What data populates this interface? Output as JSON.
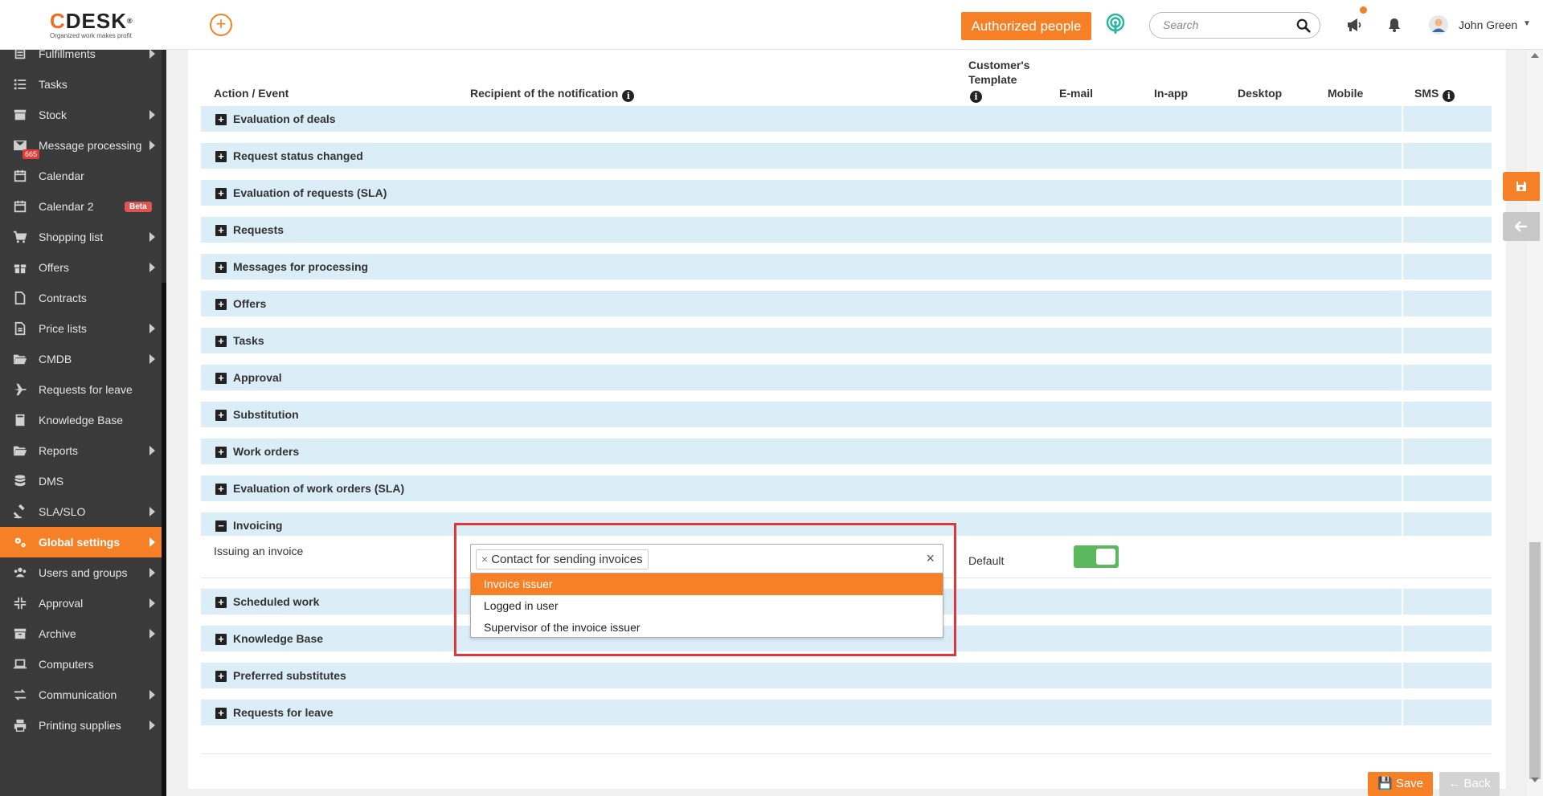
{
  "header": {
    "logo_text": "DESK",
    "logo_c": "C",
    "logo_reg": "®",
    "logo_tagline": "Organized work makes profit",
    "add_symbol": "+",
    "authorized_people_label": "Authorized people",
    "search_placeholder": "Search",
    "user_name": "John Green",
    "user_caret": "▼"
  },
  "sidebar": {
    "items": [
      {
        "label": "Fulfillments",
        "icon": "fulfillment-icon",
        "arrow": true
      },
      {
        "label": "Tasks",
        "icon": "tasks-icon",
        "arrow": false
      },
      {
        "label": "Stock",
        "icon": "stock-icon",
        "arrow": true
      },
      {
        "label": "Message processing",
        "icon": "envelope-icon",
        "arrow": true,
        "badge": "665"
      },
      {
        "label": "Calendar",
        "icon": "calendar-icon",
        "arrow": false
      },
      {
        "label": "Calendar 2",
        "icon": "calendar-icon",
        "arrow": false,
        "beta": "Beta"
      },
      {
        "label": "Shopping list",
        "icon": "cart-icon",
        "arrow": true
      },
      {
        "label": "Offers",
        "icon": "gift-icon",
        "arrow": true
      },
      {
        "label": "Contracts",
        "icon": "contract-icon",
        "arrow": false
      },
      {
        "label": "Price lists",
        "icon": "document-icon",
        "arrow": true
      },
      {
        "label": "CMDB",
        "icon": "folder-open-icon",
        "arrow": true
      },
      {
        "label": "Requests for leave",
        "icon": "plane-icon",
        "arrow": false
      },
      {
        "label": "Knowledge Base",
        "icon": "book-icon",
        "arrow": false
      },
      {
        "label": "Reports",
        "icon": "folder-open-icon",
        "arrow": true
      },
      {
        "label": "DMS",
        "icon": "database-icon",
        "arrow": false
      },
      {
        "label": "SLA/SLO",
        "icon": "gavel-icon",
        "arrow": true
      },
      {
        "label": "Global settings",
        "icon": "gears-icon",
        "arrow": true,
        "active": true
      },
      {
        "label": "Users and groups",
        "icon": "users-icon",
        "arrow": true
      },
      {
        "label": "Approval",
        "icon": "compress-icon",
        "arrow": true
      },
      {
        "label": "Archive",
        "icon": "archive-icon",
        "arrow": true
      },
      {
        "label": "Computers",
        "icon": "laptop-icon",
        "arrow": false
      },
      {
        "label": "Communication",
        "icon": "exchange-icon",
        "arrow": true
      },
      {
        "label": "Printing supplies",
        "icon": "printer-icon",
        "arrow": true
      }
    ]
  },
  "table": {
    "columns": {
      "action_event": "Action / Event",
      "recipient": "Recipient of the notification",
      "customers_template_line1": "Customer's",
      "customers_template_line2": "Template",
      "email": "E-mail",
      "in_app": "In-app",
      "desktop": "Desktop",
      "mobile": "Mobile",
      "sms": "SMS"
    },
    "info_glyph": "i",
    "sections_top": [
      {
        "label": "Evaluation of deals",
        "expanded": false
      },
      {
        "label": "Request status changed",
        "expanded": false
      },
      {
        "label": "Evaluation of requests (SLA)",
        "expanded": false
      },
      {
        "label": "Requests",
        "expanded": false
      },
      {
        "label": "Messages for processing",
        "expanded": false
      },
      {
        "label": "Offers",
        "expanded": false
      },
      {
        "label": "Tasks",
        "expanded": false
      },
      {
        "label": "Approval",
        "expanded": false
      },
      {
        "label": "Substitution",
        "expanded": false
      },
      {
        "label": "Work orders",
        "expanded": false
      },
      {
        "label": "Evaluation of work orders (SLA)",
        "expanded": false
      },
      {
        "label": "Invoicing",
        "expanded": true
      }
    ],
    "expanded_event": {
      "label": "Issuing an invoice",
      "template": "Default",
      "email_enabled": true
    },
    "sections_bottom": [
      {
        "label": "Scheduled work",
        "expanded": false
      },
      {
        "label": "Knowledge Base",
        "expanded": false
      },
      {
        "label": "Preferred substitutes",
        "expanded": false
      },
      {
        "label": "Requests for leave",
        "expanded": false
      }
    ],
    "plus_glyph": "+",
    "minus_glyph": "−"
  },
  "recipient_select": {
    "selected_chip": "Contact for sending invoices",
    "chip_remove": "×",
    "clear": "×",
    "options": [
      {
        "label": "Invoice issuer",
        "highlighted": true
      },
      {
        "label": "Logged in user",
        "highlighted": false
      },
      {
        "label": "Supervisor of the invoice issuer",
        "highlighted": false
      }
    ]
  },
  "footer": {
    "save_label": "Save",
    "back_label": "Back"
  },
  "colors": {
    "accent": "#f58025",
    "sidebar_bg": "#3a3a3a",
    "section_bg": "#dbedf7",
    "toggle_on": "#5cb85c",
    "highlight_border": "#e0353b"
  }
}
